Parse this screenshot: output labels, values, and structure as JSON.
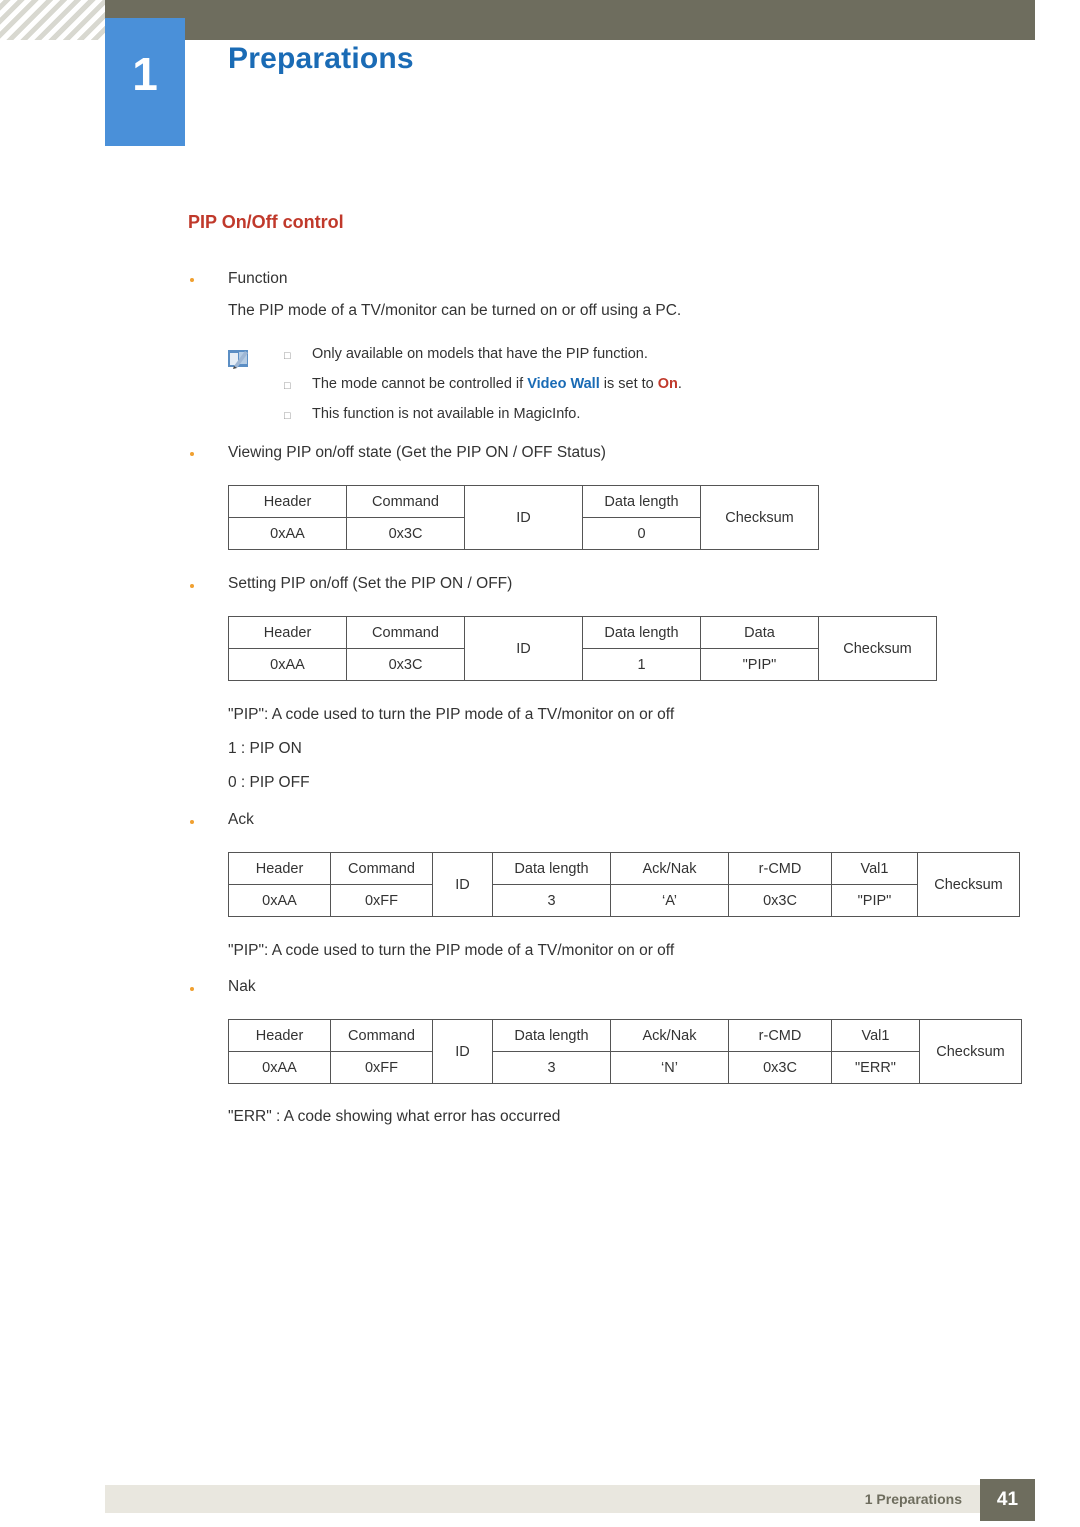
{
  "header": {
    "chapter_number": "1",
    "chapter_title": "Preparations"
  },
  "section": {
    "title": "PIP On/Off control"
  },
  "body": {
    "function_label": "Function",
    "function_desc": "The PIP mode of a TV/monitor can be turned on or off using a PC.",
    "notes": [
      "Only available on models that have the PIP function.",
      {
        "pre": "The mode cannot be controlled if ",
        "hl1": "Video Wall",
        "mid": " is set to ",
        "hl2": "On",
        "post": "."
      },
      "This function is not available in MagicInfo."
    ],
    "view_state_label": "Viewing PIP on/off state (Get the PIP ON / OFF Status)",
    "setting_label": "Setting PIP on/off (Set the PIP ON / OFF)",
    "pip_code_desc": "\"PIP\": A code used to turn the PIP mode of a TV/monitor on or off",
    "pip_on": "1 : PIP ON",
    "pip_off": "0 : PIP OFF",
    "ack_label": "Ack",
    "pip_code_desc2": "\"PIP\": A code used to turn the PIP mode of a TV/monitor on or off",
    "nak_label": "Nak",
    "err_desc": "\"ERR\" : A code showing what error has occurred"
  },
  "tables": {
    "get_status": {
      "headers": [
        "Header",
        "Command",
        "ID",
        "Data length",
        "Checksum"
      ],
      "values": [
        "0xAA",
        "0x3C",
        "0"
      ]
    },
    "set_status": {
      "headers": [
        "Header",
        "Command",
        "ID",
        "Data length",
        "Data",
        "Checksum"
      ],
      "values": [
        "0xAA",
        "0x3C",
        "1",
        "\"PIP\""
      ]
    },
    "ack": {
      "headers": [
        "Header",
        "Command",
        "ID",
        "Data length",
        "Ack/Nak",
        "r-CMD",
        "Val1",
        "Checksum"
      ],
      "values": [
        "0xAA",
        "0xFF",
        "3",
        "‘A’",
        "0x3C",
        "\"PIP\""
      ]
    },
    "nak": {
      "headers": [
        "Header",
        "Command",
        "ID",
        "Data length",
        "Ack/Nak",
        "r-CMD",
        "Val1",
        "Checksum"
      ],
      "values": [
        "0xAA",
        "0xFF",
        "3",
        "‘N’",
        "0x3C",
        "\"ERR\""
      ]
    }
  },
  "footer": {
    "label": "1 Preparations",
    "page": "41"
  }
}
